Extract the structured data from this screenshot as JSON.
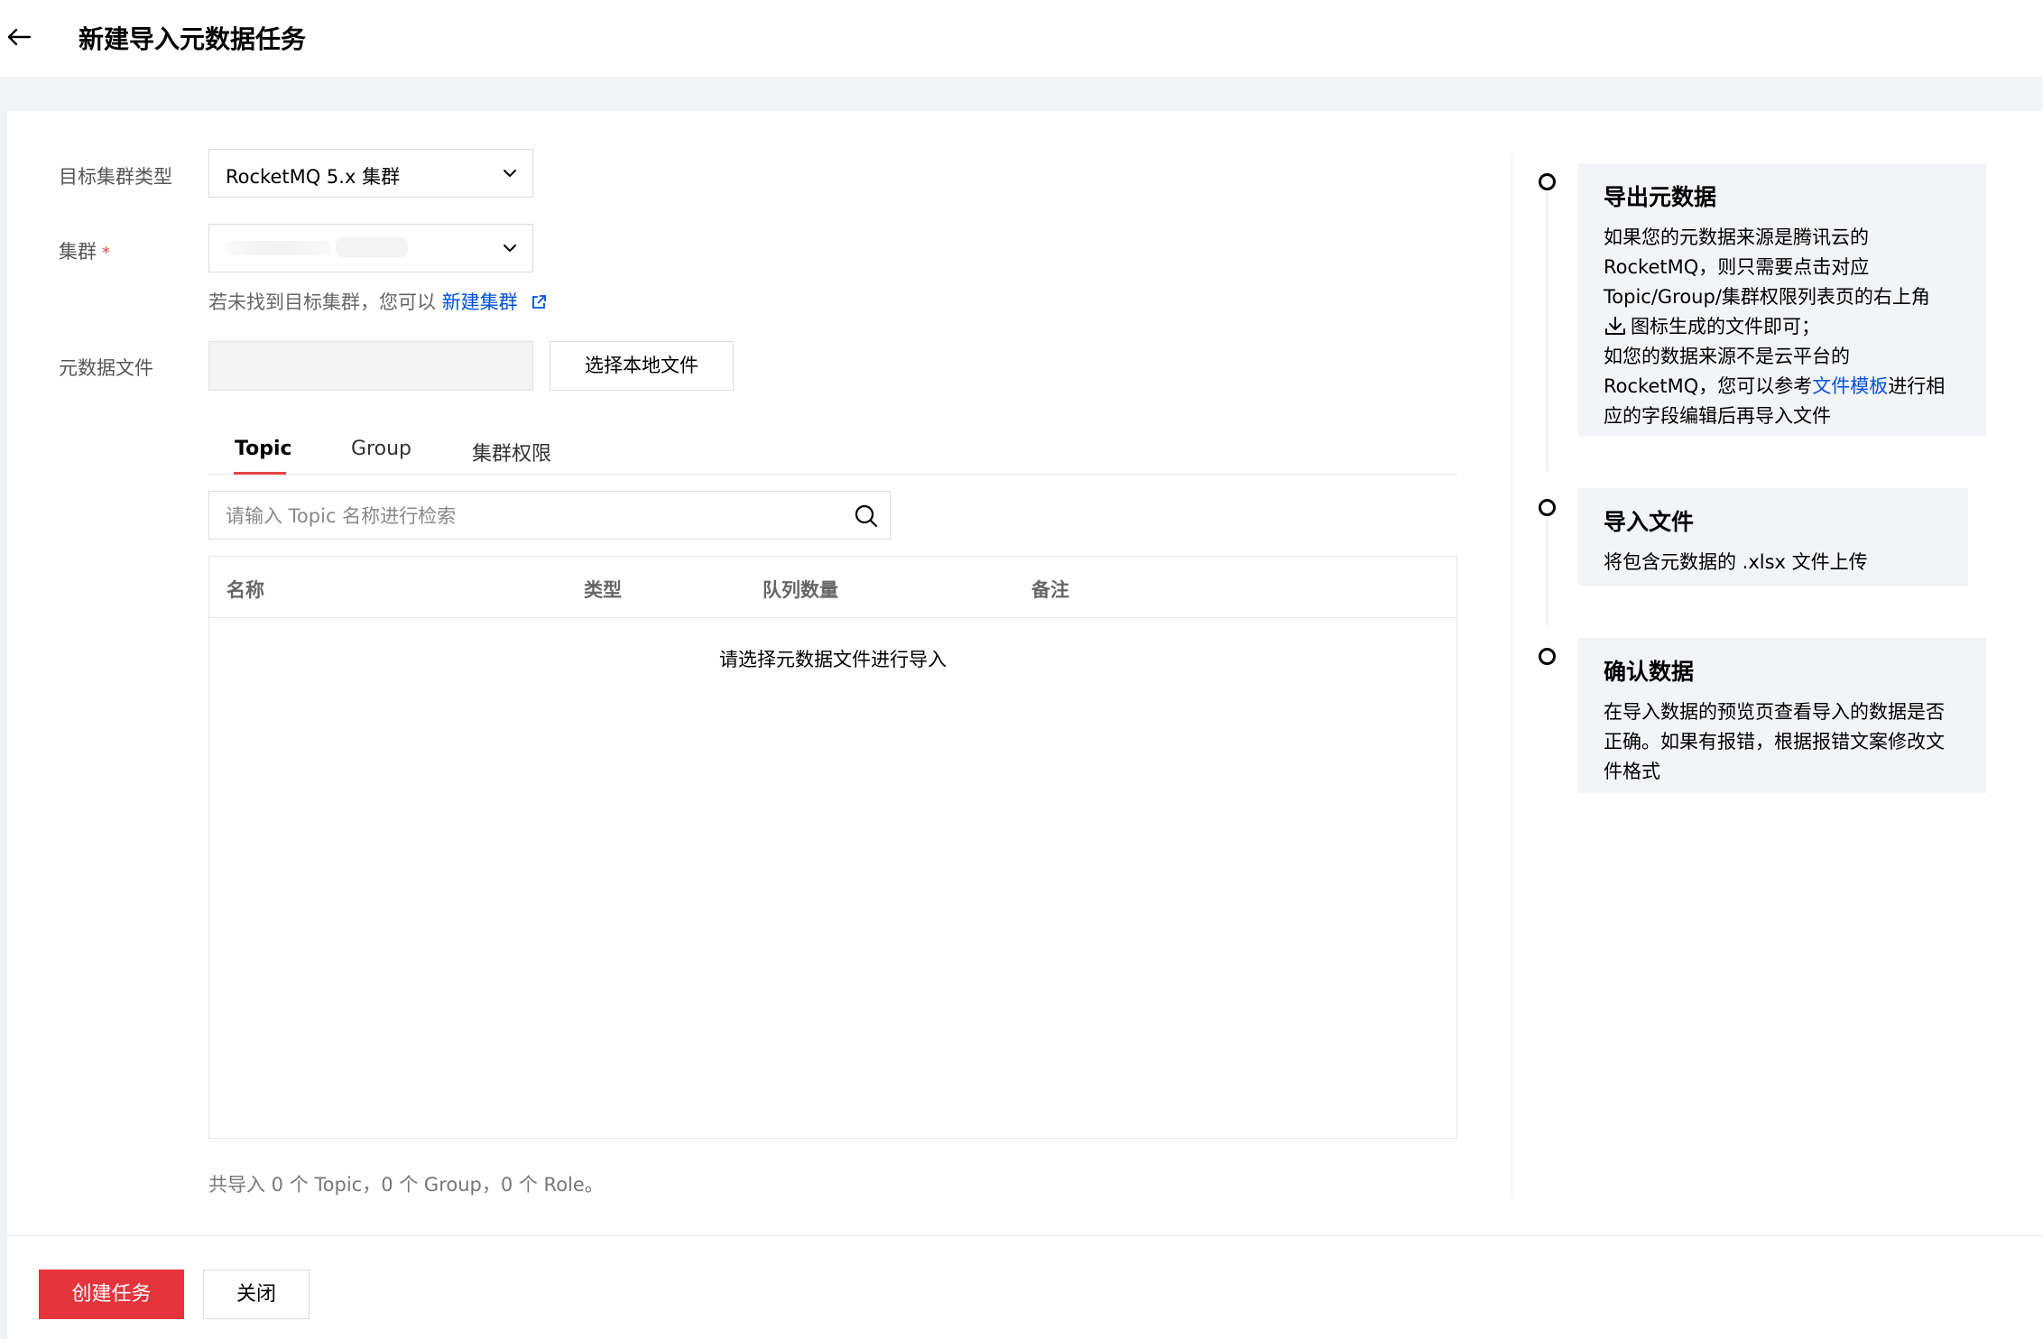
{
  "header": {
    "title": "新建导入元数据任务"
  },
  "form": {
    "cluster_type_label": "目标集群类型",
    "cluster_type_value": "RocketMQ 5.x 集群",
    "cluster_label": "集群",
    "required_mark": "*",
    "hint_text": "若未找到目标集群，您可以",
    "hint_link": "新建集群",
    "file_label": "元数据文件",
    "file_button": "选择本地文件"
  },
  "tabs": [
    {
      "label": "Topic",
      "active": true
    },
    {
      "label": "Group",
      "active": false
    },
    {
      "label": "集群权限",
      "active": false
    }
  ],
  "search": {
    "placeholder": "请输入 Topic 名称进行检索"
  },
  "table": {
    "columns": [
      "名称",
      "类型",
      "队列数量",
      "备注"
    ],
    "empty_text": "请选择元数据文件进行导入"
  },
  "summary": "共导入 0 个 Topic，0 个 Group，0 个 Role。",
  "steps": [
    {
      "title": "导出元数据",
      "line1": "如果您的元数据来源是腾讯云的",
      "line2": "RocketMQ，则只需要点击对应",
      "line3": "Topic/Group/集群权限列表页的右上角",
      "line4": "图标生成的文件即可；",
      "line5": "如您的数据来源不是云平台的",
      "line6_pre": "RocketMQ，您可以参考",
      "line6_link": "文件模板",
      "line6_post": "进行相",
      "line7": "应的字段编辑后再导入文件"
    },
    {
      "title": "导入文件",
      "desc": "将包含元数据的 .xlsx 文件上传"
    },
    {
      "title": "确认数据",
      "line1": "在导入数据的预览页查看导入的数据是否",
      "line2": "正确。如果有报错，根据报错文案修改文",
      "line3": "件格式"
    }
  ],
  "footer": {
    "create_label": "创建任务",
    "close_label": "关闭"
  },
  "colors": {
    "primary": "#e5343c",
    "link": "#0052d9",
    "tab_active_underline": "#e54545",
    "step_bg": "#f3f4f7"
  },
  "icons": [
    "back-arrow-icon",
    "chevron-down-icon",
    "external-link-icon",
    "search-icon",
    "download-icon"
  ]
}
